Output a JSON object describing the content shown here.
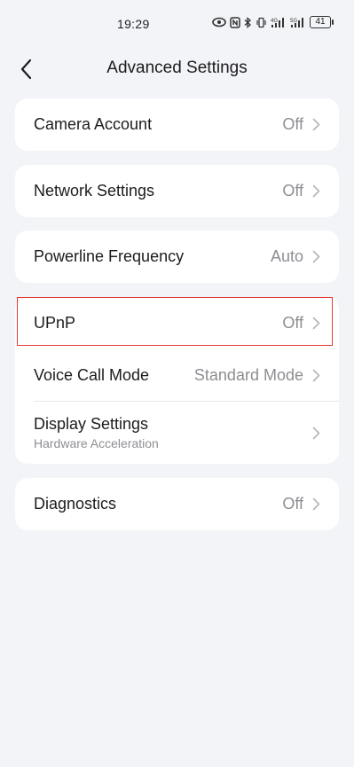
{
  "status_bar": {
    "time": "19:29",
    "battery": "41",
    "icons": [
      "eye-icon",
      "nfc-icon",
      "bluetooth-icon",
      "vibrate-icon",
      "signal-4g-icon",
      "signal-5g-icon",
      "battery-icon"
    ],
    "signal_4g": "4G",
    "signal_5g": "5G"
  },
  "header": {
    "title": "Advanced Settings",
    "back_icon": "chevron-left-icon"
  },
  "sections": {
    "camera_account": {
      "label": "Camera Account",
      "value": "Off"
    },
    "network_settings": {
      "label": "Network Settings",
      "value": "Off"
    },
    "powerline_frequency": {
      "label": "Powerline Frequency",
      "value": "Auto"
    },
    "upnp": {
      "label": "UPnP",
      "value": "Off"
    },
    "voice_call_mode": {
      "label": "Voice Call Mode",
      "value": "Standard Mode"
    },
    "display_settings": {
      "label": "Display Settings",
      "sublabel": "Hardware Acceleration"
    },
    "diagnostics": {
      "label": "Diagnostics",
      "value": "Off"
    }
  },
  "colors": {
    "background": "#f3f4f8",
    "card": "#ffffff",
    "highlight": "#e53935",
    "secondary_text": "#8e8e93"
  }
}
